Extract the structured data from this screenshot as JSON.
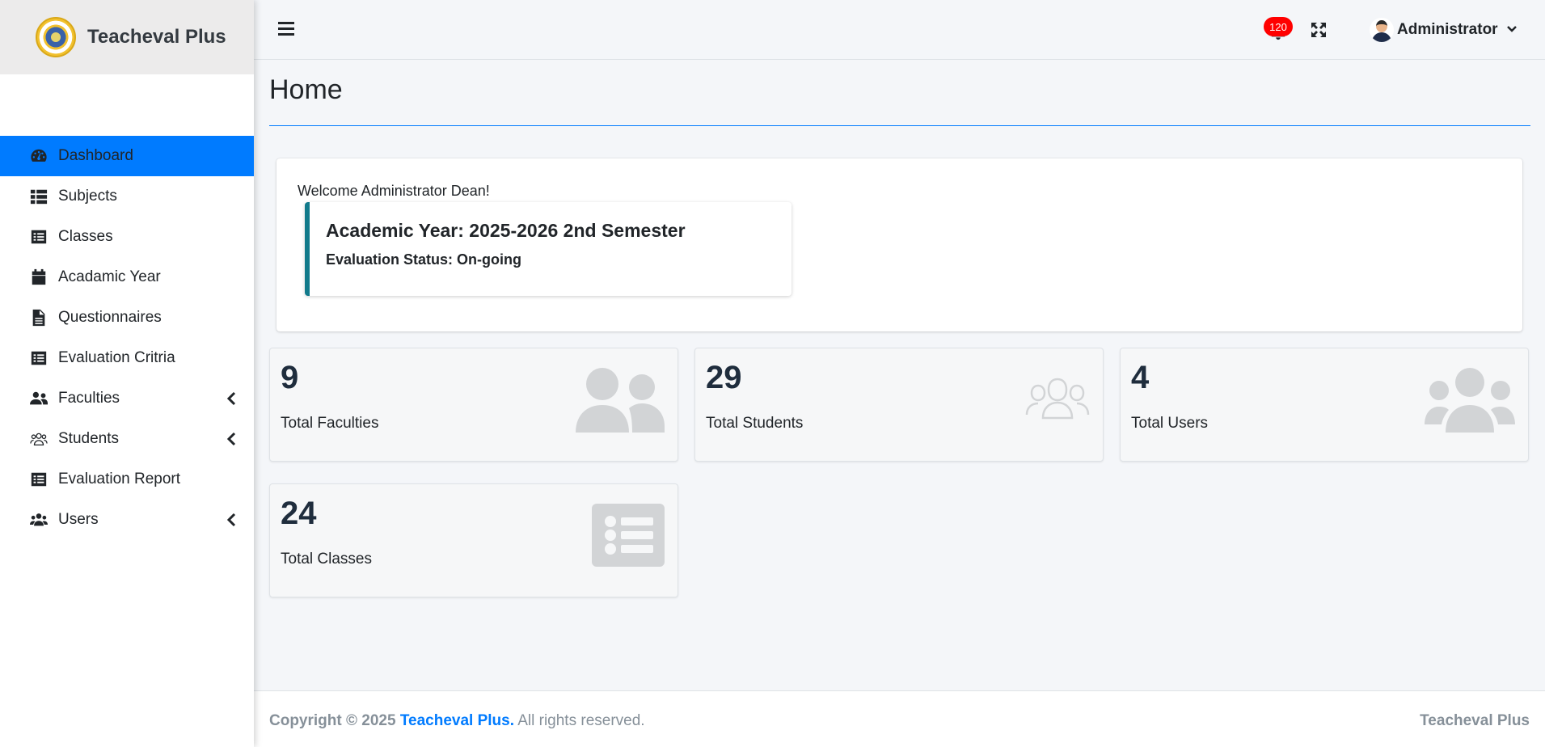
{
  "app": {
    "brand": "Teacheval Plus"
  },
  "sidebar": {
    "items": [
      {
        "label": "Dashboard",
        "icon": "tachometer-icon",
        "active": true
      },
      {
        "label": "Subjects",
        "icon": "list-icon"
      },
      {
        "label": "Classes",
        "icon": "list-alt-icon"
      },
      {
        "label": "Acadamic Year",
        "icon": "calendar-icon"
      },
      {
        "label": "Questionnaires",
        "icon": "file-icon"
      },
      {
        "label": "Evaluation Critria",
        "icon": "list-alt-icon"
      },
      {
        "label": "Faculties",
        "icon": "user-friends-icon",
        "expandable": true
      },
      {
        "label": "Students",
        "icon": "users-outline-icon",
        "expandable": true
      },
      {
        "label": "Evaluation Report",
        "icon": "list-alt-icon"
      },
      {
        "label": "Users",
        "icon": "users-icon",
        "expandable": true
      }
    ]
  },
  "header": {
    "notification_count": "120",
    "user_name": "Administrator"
  },
  "page": {
    "title": "Home",
    "welcome": "Welcome Administrator Dean!",
    "academic_year": "Academic Year: 2025-2026 2nd Semester",
    "evaluation_status": "Evaluation Status: On-going"
  },
  "stats": [
    {
      "value": "9",
      "label": "Total Faculties",
      "icon": "user-friends-icon"
    },
    {
      "value": "29",
      "label": "Total Students",
      "icon": "users-outline-icon"
    },
    {
      "value": "4",
      "label": "Total Users",
      "icon": "users-icon"
    },
    {
      "value": "24",
      "label": "Total Classes",
      "icon": "list-alt-icon"
    }
  ],
  "footer": {
    "copyright_prefix": "Copyright © 2025",
    "brand": "Teacheval Plus.",
    "rights": "All rights reserved.",
    "right_text": "Teacheval Plus"
  },
  "colors": {
    "accent": "#007bff",
    "callout_border": "#117a8b",
    "badge": "#ff0000",
    "stat_icon": "#d2d4d6"
  }
}
